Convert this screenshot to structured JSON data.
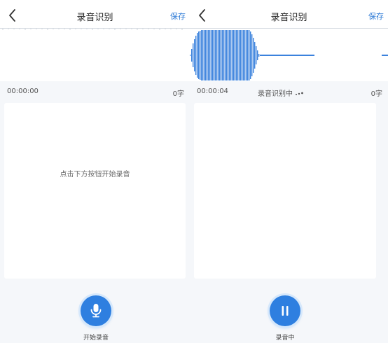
{
  "left_screen": {
    "title": "录音识别",
    "save_label": "保存",
    "time": "00:00:00",
    "char_count": "0字",
    "hint": "点击下方按钮开始录音",
    "button_label": "开始录音",
    "button_icon": "microphone-icon"
  },
  "right_screen": {
    "title": "录音识别",
    "save_label": "保存",
    "time": "00:00:04",
    "status": "录音识别中",
    "char_count": "0字",
    "button_label": "录音中",
    "button_icon": "pause-icon"
  },
  "colors": {
    "accent": "#2e7bd6",
    "waveform": "#3b82dd",
    "background": "#f5f7fa"
  }
}
